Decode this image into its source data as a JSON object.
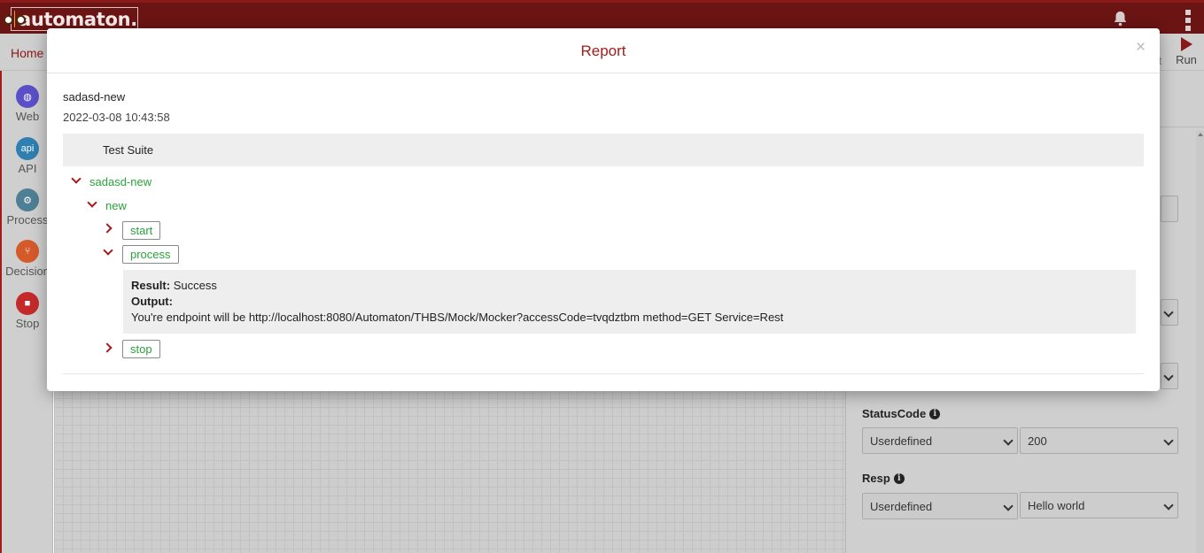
{
  "app": {
    "logo_text": "automaton."
  },
  "nav": {
    "home": "Home",
    "run": "Run",
    "partial_label": "t"
  },
  "tools": [
    {
      "label": "Web",
      "icon": "globe-icon",
      "color": "#5b4fc7",
      "glyph": "◍"
    },
    {
      "label": "API",
      "icon": "api-icon",
      "color": "#2f7fb0",
      "glyph": "api"
    },
    {
      "label": "Process",
      "icon": "gear-icon",
      "color": "#4f7f94",
      "glyph": "⚙"
    },
    {
      "label": "Decision",
      "icon": "decision-icon",
      "color": "#d45a2a",
      "glyph": "⑂"
    },
    {
      "label": "Stop",
      "icon": "stop-icon",
      "color": "#c42a2a",
      "glyph": "■"
    }
  ],
  "right_panel": {
    "status_code": {
      "label": "StatusCode",
      "type_value": "Userdefined",
      "value": "200"
    },
    "resp": {
      "label": "Resp",
      "type_value": "Userdefined",
      "value": "Hello world"
    }
  },
  "modal": {
    "title": "Report",
    "close": "×",
    "suite_name": "sadasd-new",
    "suite_date": "2022-03-08 10:43:58",
    "suite_header": "Test Suite",
    "tree": {
      "root": "sadasd-new",
      "child": "new",
      "steps": [
        {
          "label": "start",
          "expanded": false
        },
        {
          "label": "process",
          "expanded": true
        },
        {
          "label": "stop",
          "expanded": false
        }
      ]
    },
    "result": {
      "result_label": "Result:",
      "result_value": "Success",
      "output_label": "Output:",
      "output_value": "You're endpoint will be http://localhost:8080/Automaton/THBS/Mock/Mocker?accessCode=tvqdztbm method=GET Service=Rest"
    }
  }
}
